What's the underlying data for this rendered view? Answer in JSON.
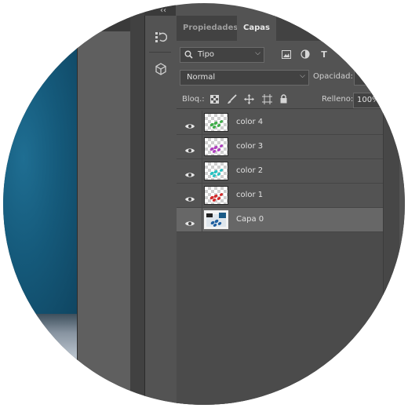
{
  "panel": {
    "tabs": [
      {
        "label": "Propiedades",
        "active": false
      },
      {
        "label": "Capas",
        "active": true
      }
    ],
    "filter": {
      "label": "Tipo",
      "icons": [
        "image-filter-icon",
        "adjustment-filter-icon",
        "type-filter-icon"
      ]
    },
    "blend_mode": "Normal",
    "opacity": {
      "label": "Opacidad:",
      "value": ""
    },
    "lock": {
      "label": "Bloq.:",
      "icons": [
        "lock-transparent-pixels-icon",
        "lock-image-pixels-icon",
        "lock-position-icon",
        "lock-artboard-icon",
        "lock-all-icon"
      ]
    },
    "fill": {
      "label": "Relleno:",
      "value": "100%"
    }
  },
  "layers": [
    {
      "name": "color 4",
      "color": "#3fae49",
      "selected": false
    },
    {
      "name": "color 3",
      "color": "#b040c0",
      "selected": false
    },
    {
      "name": "color 2",
      "color": "#27c4c4",
      "selected": false
    },
    {
      "name": "color 1",
      "color": "#d42a2a",
      "selected": false
    },
    {
      "name": "Capa 0",
      "color": "#1f5fa0",
      "selected": true
    }
  ],
  "colors": {
    "canvas": "#155a7b",
    "panel": "#535353",
    "selected_layer": "#676767"
  }
}
